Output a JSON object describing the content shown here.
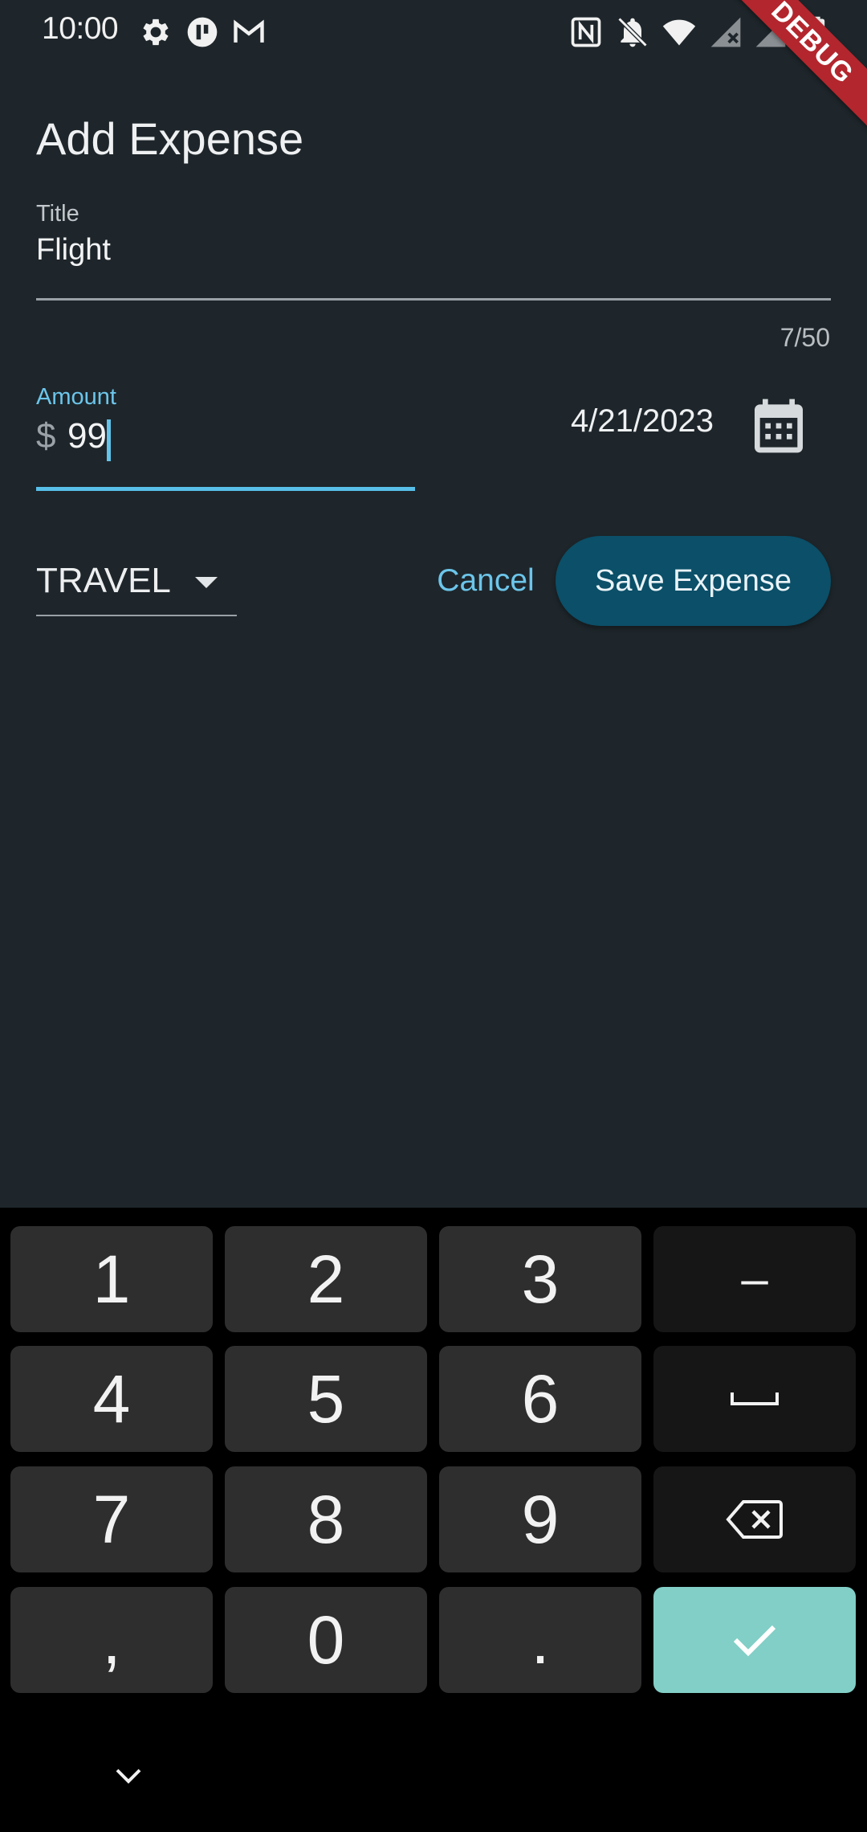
{
  "status_bar": {
    "time": "10:00",
    "left_icons": [
      "gear-icon",
      "app-icon",
      "gmail-icon"
    ],
    "right_icons": [
      "nfc-icon",
      "bell-off-icon",
      "wifi-icon",
      "signal-icon",
      "no-sim-icon",
      "battery-icon"
    ]
  },
  "debug_banner": "DEBUG",
  "form": {
    "heading": "Add Expense",
    "title_field": {
      "label": "Title",
      "value": "Flight",
      "counter": "7/50"
    },
    "amount_field": {
      "label": "Amount",
      "prefix": "$",
      "value": "99"
    },
    "date": "4/21/2023",
    "category": "TRAVEL",
    "cancel_label": "Cancel",
    "save_label": "Save Expense"
  },
  "keyboard": {
    "keys": [
      "1",
      "2",
      "3",
      "–",
      "4",
      "5",
      "6",
      "␣",
      "7",
      "8",
      "9",
      "⌫",
      ",",
      "0",
      ".",
      "✓"
    ]
  },
  "colors": {
    "background": "#1e262b",
    "accent": "#58bfe8",
    "save_button": "#0b4f68",
    "confirm_key": "#82cfc7",
    "debug_ribbon": "#b3262d"
  }
}
